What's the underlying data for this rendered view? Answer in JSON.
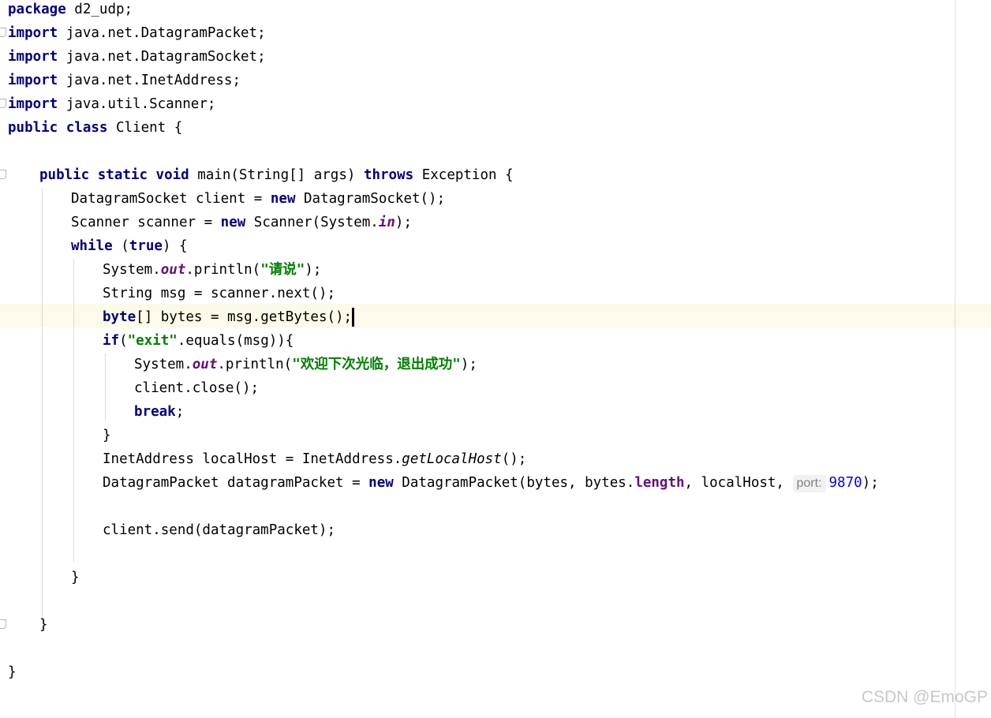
{
  "code": {
    "package_kw": "package",
    "package_name": " d2_udp;",
    "imports": [
      {
        "kw": "import",
        "text": " java.net.DatagramPacket;"
      },
      {
        "kw": "import",
        "text": " java.net.DatagramSocket;"
      },
      {
        "kw": "import",
        "text": " java.net.InetAddress;"
      },
      {
        "kw": "import",
        "text": " java.util.Scanner;"
      }
    ],
    "class_line": {
      "kw1": "public",
      "kw2": "class",
      "rest": " Client {"
    },
    "main_line": {
      "kw1": "public",
      "kw2": "static",
      "kw3": "void",
      "mid": " main(String[] args) ",
      "kw4": "throws",
      "rest": " Exception {"
    },
    "socket_line": {
      "pre": "DatagramSocket client = ",
      "kw": "new",
      "rest": " DatagramSocket();"
    },
    "scanner_line": {
      "pre": "Scanner scanner = ",
      "kw": "new",
      "mid": " Scanner(System.",
      "field": "in",
      "rest": ");"
    },
    "while_line": {
      "kw": "while",
      "mid": " (",
      "kw2": "true",
      "rest": ") {"
    },
    "println1": {
      "pre": "System.",
      "field": "out",
      "mid": ".println(",
      "str": "\"请说\"",
      "rest": ");"
    },
    "msg_line": "String msg = scanner.next();",
    "bytes_line": {
      "kw": "byte",
      "rest": "[] bytes = msg.getBytes();"
    },
    "if_line": {
      "kw": "if",
      "mid": "(",
      "str": "\"exit\"",
      "rest": ".equals(msg)){"
    },
    "println2": {
      "pre": "System.",
      "field": "out",
      "mid": ".println(",
      "str": "\"欢迎下次光临，退出成功\"",
      "rest": ");"
    },
    "close_line": "client.close();",
    "break_line": {
      "kw": "break",
      "rest": ";"
    },
    "if_close": "}",
    "localhost_line": {
      "pre": "InetAddress localHost = InetAddress.",
      "call": "getLocalHost",
      "rest": "();"
    },
    "packet_line": {
      "pre": "DatagramPacket datagramPacket = ",
      "kw": "new",
      "mid": " DatagramPacket(bytes, bytes.",
      "field": "length",
      "mid2": ", localHost, ",
      "hint": "port:",
      "num": "9870",
      "rest": ");"
    },
    "send_line": "client.send(datagramPacket);",
    "while_close": "}",
    "main_close": "}",
    "class_close": "}"
  },
  "watermark": "CSDN @EmoGP"
}
